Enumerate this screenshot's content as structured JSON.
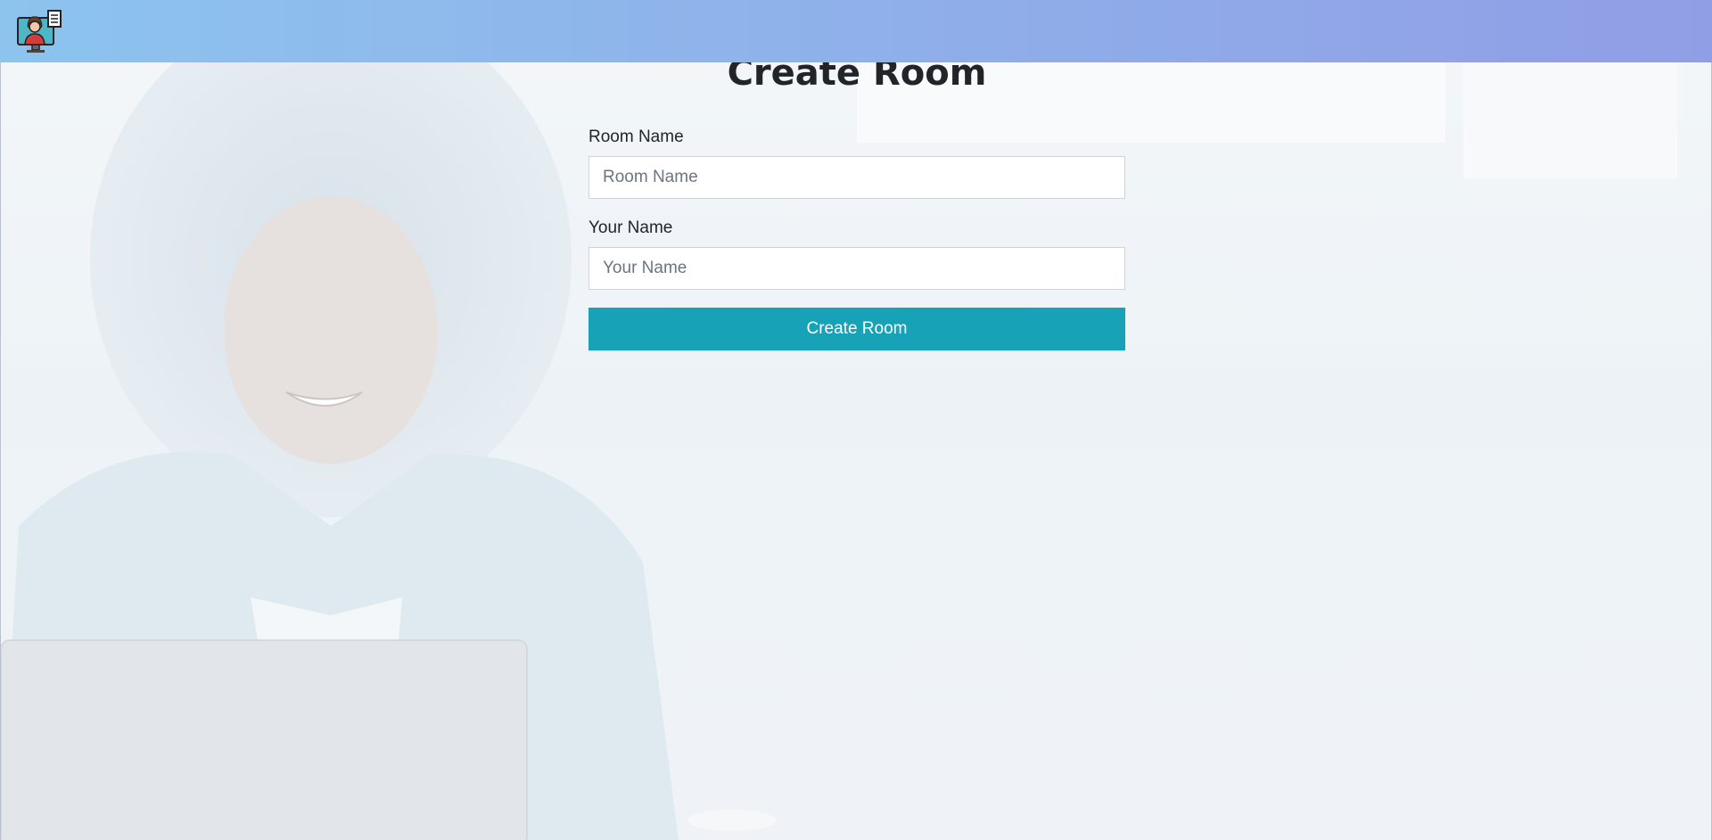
{
  "navbar": {
    "logo_icon": "video-call-person-icon",
    "gradient_start": "#8cc4ee",
    "gradient_end": "#909ee6"
  },
  "form": {
    "title": "Create Room",
    "room_name_label": "Room Name",
    "room_name_placeholder": "Room Name",
    "room_name_value": "",
    "your_name_label": "Your Name",
    "your_name_placeholder": "Your Name",
    "your_name_value": "",
    "submit_label": "Create Room",
    "submit_color": "#17a2b8"
  }
}
